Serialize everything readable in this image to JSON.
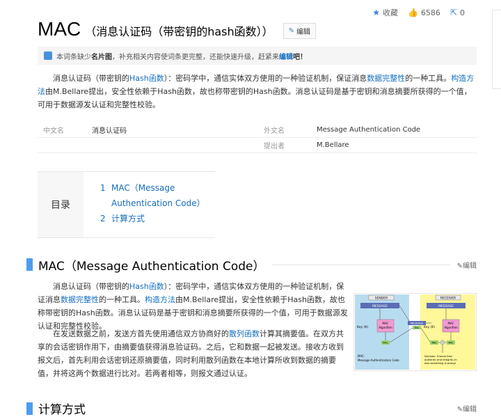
{
  "topbar": {
    "favorite": "收藏",
    "likes": "6586",
    "shares": "0"
  },
  "title": {
    "main": "MAC",
    "sub": "（消息认证码（带密钥的hash函数））",
    "edit": "编辑"
  },
  "notice": {
    "pre": "本词条缺少",
    "bold": "名片图",
    "mid": "，补充相关内容使词条更完整，还能快速升级，赶紧来",
    "link": "编辑",
    "post": "吧！"
  },
  "intro": {
    "t1": "消息认证码（带密钥的",
    "l1": "Hash函数",
    "t2": "）：密码学中，通信实体双方使用的一种验证机制，保证消息",
    "l2": "数据完整性",
    "t3": "的一种工具。",
    "l3": "构造方法",
    "t4": "由M.Bellare提出，安全性依赖于Hash函数，故也称带密钥的Hash函数。消息认证码是基于密钥和消息摘要所获得的一个值，可用于数据源发认证和完整性校验。"
  },
  "info": {
    "rows": [
      {
        "k1": "中文名",
        "v1": "消息认证码",
        "k2": "外文名",
        "v2": "Message Authentication Code"
      },
      {
        "k1": "",
        "v1": "",
        "k2": "提出者",
        "v2": "M.Bellare"
      }
    ]
  },
  "toc": {
    "label": "目录",
    "items": [
      {
        "num": "1",
        "line1": "MAC（Message",
        "line2": "Authentication Code）"
      },
      {
        "num": "2",
        "line1": "计算方式",
        "line2": ""
      }
    ]
  },
  "section1": {
    "title": "MAC（Message Authentication Code）",
    "edit": "编辑",
    "p1": {
      "t1": "消息认证码（带密钥的",
      "l1": "Hash函数",
      "t2": "）：密码学中，通信实体双方使用的一种验证机制，保证消息",
      "l2": "数据完整性",
      "t3": "的一种工具。",
      "l3": "构造方法",
      "t4": "由M.Bellare提出，安全性依赖于Hash函数，故也称带密钥的Hash函数。消息认证码是基于密钥和消息摘要所获得的一个值，可用于数据源发认证和完整性校验。"
    },
    "p2": {
      "t1": "在发送数据之前，发送方首先使用通信双方协商好的",
      "l1": "散列函数",
      "t2": "计算其摘要值。在双方共享的会话密钥作用下，由摘要值获得消息验证码。之后，它和数据一起被发送。接收方收到报文后，首先利用会话密钥还原摘要值，同时利用散列函数在本地计算所收到数据的摘要值，并将这两个数据进行比对。若两者相等，则报文通过认证。"
    }
  },
  "figure": {
    "sender": "SENDER",
    "receiver": "RECEIVER",
    "message": "MESSAGE",
    "key": "Key (K)",
    "algo1": "MAC",
    "algo2": "Algorithm",
    "mac": "MAC",
    "caption1": "MAC:",
    "caption2": "Message Authentication Code",
    "decision1": "Decision: If same then",
    "decision2": "authentic and integrity ch",
    "decision3": "else something is wrong!"
  },
  "section2": {
    "title": "计算方式",
    "edit": "编辑"
  },
  "colors": {
    "link": "#136ec2",
    "accent": "#4f9cee",
    "senderBg": "#b8dcef",
    "receiverBg": "#fff799",
    "algo": "#f29bd3",
    "macBox": "#9bd36a"
  }
}
